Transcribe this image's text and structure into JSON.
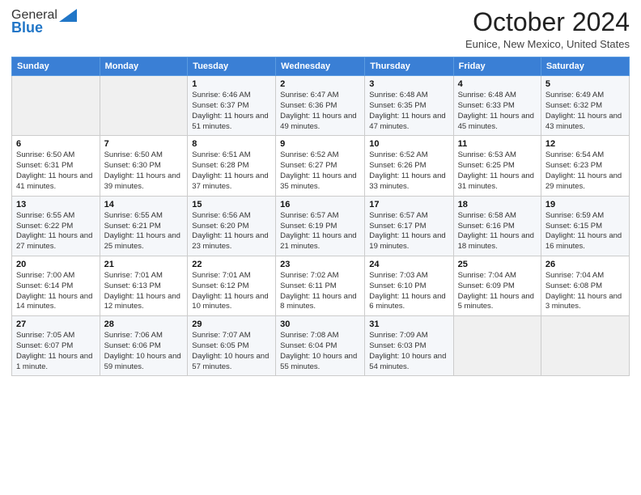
{
  "logo": {
    "general": "General",
    "blue": "Blue"
  },
  "title": "October 2024",
  "location": "Eunice, New Mexico, United States",
  "days_of_week": [
    "Sunday",
    "Monday",
    "Tuesday",
    "Wednesday",
    "Thursday",
    "Friday",
    "Saturday"
  ],
  "weeks": [
    [
      {
        "day": "",
        "sunrise": "",
        "sunset": "",
        "daylight": ""
      },
      {
        "day": "",
        "sunrise": "",
        "sunset": "",
        "daylight": ""
      },
      {
        "day": "1",
        "sunrise": "Sunrise: 6:46 AM",
        "sunset": "Sunset: 6:37 PM",
        "daylight": "Daylight: 11 hours and 51 minutes."
      },
      {
        "day": "2",
        "sunrise": "Sunrise: 6:47 AM",
        "sunset": "Sunset: 6:36 PM",
        "daylight": "Daylight: 11 hours and 49 minutes."
      },
      {
        "day": "3",
        "sunrise": "Sunrise: 6:48 AM",
        "sunset": "Sunset: 6:35 PM",
        "daylight": "Daylight: 11 hours and 47 minutes."
      },
      {
        "day": "4",
        "sunrise": "Sunrise: 6:48 AM",
        "sunset": "Sunset: 6:33 PM",
        "daylight": "Daylight: 11 hours and 45 minutes."
      },
      {
        "day": "5",
        "sunrise": "Sunrise: 6:49 AM",
        "sunset": "Sunset: 6:32 PM",
        "daylight": "Daylight: 11 hours and 43 minutes."
      }
    ],
    [
      {
        "day": "6",
        "sunrise": "Sunrise: 6:50 AM",
        "sunset": "Sunset: 6:31 PM",
        "daylight": "Daylight: 11 hours and 41 minutes."
      },
      {
        "day": "7",
        "sunrise": "Sunrise: 6:50 AM",
        "sunset": "Sunset: 6:30 PM",
        "daylight": "Daylight: 11 hours and 39 minutes."
      },
      {
        "day": "8",
        "sunrise": "Sunrise: 6:51 AM",
        "sunset": "Sunset: 6:28 PM",
        "daylight": "Daylight: 11 hours and 37 minutes."
      },
      {
        "day": "9",
        "sunrise": "Sunrise: 6:52 AM",
        "sunset": "Sunset: 6:27 PM",
        "daylight": "Daylight: 11 hours and 35 minutes."
      },
      {
        "day": "10",
        "sunrise": "Sunrise: 6:52 AM",
        "sunset": "Sunset: 6:26 PM",
        "daylight": "Daylight: 11 hours and 33 minutes."
      },
      {
        "day": "11",
        "sunrise": "Sunrise: 6:53 AM",
        "sunset": "Sunset: 6:25 PM",
        "daylight": "Daylight: 11 hours and 31 minutes."
      },
      {
        "day": "12",
        "sunrise": "Sunrise: 6:54 AM",
        "sunset": "Sunset: 6:23 PM",
        "daylight": "Daylight: 11 hours and 29 minutes."
      }
    ],
    [
      {
        "day": "13",
        "sunrise": "Sunrise: 6:55 AM",
        "sunset": "Sunset: 6:22 PM",
        "daylight": "Daylight: 11 hours and 27 minutes."
      },
      {
        "day": "14",
        "sunrise": "Sunrise: 6:55 AM",
        "sunset": "Sunset: 6:21 PM",
        "daylight": "Daylight: 11 hours and 25 minutes."
      },
      {
        "day": "15",
        "sunrise": "Sunrise: 6:56 AM",
        "sunset": "Sunset: 6:20 PM",
        "daylight": "Daylight: 11 hours and 23 minutes."
      },
      {
        "day": "16",
        "sunrise": "Sunrise: 6:57 AM",
        "sunset": "Sunset: 6:19 PM",
        "daylight": "Daylight: 11 hours and 21 minutes."
      },
      {
        "day": "17",
        "sunrise": "Sunrise: 6:57 AM",
        "sunset": "Sunset: 6:17 PM",
        "daylight": "Daylight: 11 hours and 19 minutes."
      },
      {
        "day": "18",
        "sunrise": "Sunrise: 6:58 AM",
        "sunset": "Sunset: 6:16 PM",
        "daylight": "Daylight: 11 hours and 18 minutes."
      },
      {
        "day": "19",
        "sunrise": "Sunrise: 6:59 AM",
        "sunset": "Sunset: 6:15 PM",
        "daylight": "Daylight: 11 hours and 16 minutes."
      }
    ],
    [
      {
        "day": "20",
        "sunrise": "Sunrise: 7:00 AM",
        "sunset": "Sunset: 6:14 PM",
        "daylight": "Daylight: 11 hours and 14 minutes."
      },
      {
        "day": "21",
        "sunrise": "Sunrise: 7:01 AM",
        "sunset": "Sunset: 6:13 PM",
        "daylight": "Daylight: 11 hours and 12 minutes."
      },
      {
        "day": "22",
        "sunrise": "Sunrise: 7:01 AM",
        "sunset": "Sunset: 6:12 PM",
        "daylight": "Daylight: 11 hours and 10 minutes."
      },
      {
        "day": "23",
        "sunrise": "Sunrise: 7:02 AM",
        "sunset": "Sunset: 6:11 PM",
        "daylight": "Daylight: 11 hours and 8 minutes."
      },
      {
        "day": "24",
        "sunrise": "Sunrise: 7:03 AM",
        "sunset": "Sunset: 6:10 PM",
        "daylight": "Daylight: 11 hours and 6 minutes."
      },
      {
        "day": "25",
        "sunrise": "Sunrise: 7:04 AM",
        "sunset": "Sunset: 6:09 PM",
        "daylight": "Daylight: 11 hours and 5 minutes."
      },
      {
        "day": "26",
        "sunrise": "Sunrise: 7:04 AM",
        "sunset": "Sunset: 6:08 PM",
        "daylight": "Daylight: 11 hours and 3 minutes."
      }
    ],
    [
      {
        "day": "27",
        "sunrise": "Sunrise: 7:05 AM",
        "sunset": "Sunset: 6:07 PM",
        "daylight": "Daylight: 11 hours and 1 minute."
      },
      {
        "day": "28",
        "sunrise": "Sunrise: 7:06 AM",
        "sunset": "Sunset: 6:06 PM",
        "daylight": "Daylight: 10 hours and 59 minutes."
      },
      {
        "day": "29",
        "sunrise": "Sunrise: 7:07 AM",
        "sunset": "Sunset: 6:05 PM",
        "daylight": "Daylight: 10 hours and 57 minutes."
      },
      {
        "day": "30",
        "sunrise": "Sunrise: 7:08 AM",
        "sunset": "Sunset: 6:04 PM",
        "daylight": "Daylight: 10 hours and 55 minutes."
      },
      {
        "day": "31",
        "sunrise": "Sunrise: 7:09 AM",
        "sunset": "Sunset: 6:03 PM",
        "daylight": "Daylight: 10 hours and 54 minutes."
      },
      {
        "day": "",
        "sunrise": "",
        "sunset": "",
        "daylight": ""
      },
      {
        "day": "",
        "sunrise": "",
        "sunset": "",
        "daylight": ""
      }
    ]
  ]
}
